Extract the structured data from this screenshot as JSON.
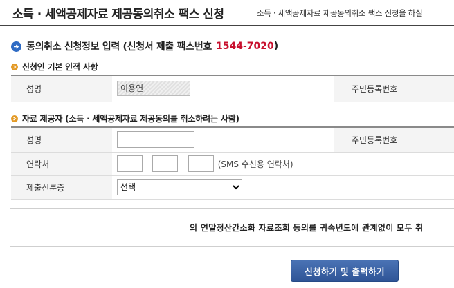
{
  "header": {
    "title": "소득 · 세액공제자료 제공동의취소 팩스 신청",
    "subtitle": "소득 · 세액공제자료 제공동의취소 팩스 신청을 하실"
  },
  "section": {
    "title": "동의취소 신청정보 입력 (신청서 제출 팩스번호",
    "fax_number": "1544-7020",
    "close_paren": ")"
  },
  "applicant": {
    "title": "신청인 기본 인적 사항",
    "name_label": "성명",
    "name_value": "이용연",
    "rrn_label": "주민등록번호"
  },
  "provider": {
    "title": "자료 제공자 (소득 · 세액공제자료 제공동의를 취소하려는 사람)",
    "name_label": "성명",
    "rrn_label": "주민등록번호",
    "contact_label": "연락처",
    "dash": "-",
    "contact_note": "(SMS 수신용 연락처)",
    "id_label": "제출신분증",
    "id_selected": "선택"
  },
  "notice": {
    "text": "의 연말정산간소화 자료조회 동의를 귀속년도에 관계없이 모두 취"
  },
  "submit": {
    "label": "신청하기 및 출력하기"
  },
  "colors": {
    "accent_blue": "#2e6bc4",
    "fax_red": "#c8102e",
    "bullet_orange": "#e39a26",
    "button_blue": "#2f5597"
  }
}
